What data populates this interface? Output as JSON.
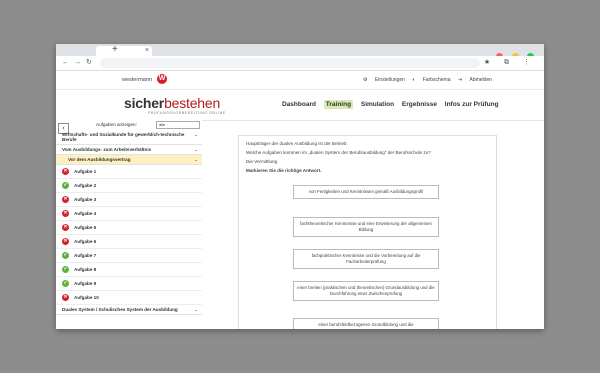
{
  "browser": {
    "newtab": "+",
    "tab_close": "×",
    "nav": {
      "back": "←",
      "forward": "→",
      "reload": "↻"
    },
    "omni_icons": "★ ⧉ ⋮",
    "dot_colors": [
      "#ff5f57",
      "#febc2e",
      "#28c840"
    ]
  },
  "topbar": {
    "brand": "westermann",
    "logo_letter": "W",
    "links": [
      "Einstellungen",
      "Farbschema",
      "Abmelden"
    ]
  },
  "header": {
    "logo_part1": "sicher",
    "logo_part2": "bestehen",
    "tagline": "PRÜFUNGSVORBEREITUNG ONLINE",
    "nav": [
      "Dashboard",
      "Training",
      "Simulation",
      "Ergebnisse",
      "Infos zur Prüfung"
    ],
    "active_nav": "Training"
  },
  "sidebar": {
    "filter_label": "Aufgaben anzeigen:",
    "filter_value": "alle",
    "collapse_icon": "‹",
    "chevron": "⌄",
    "sections": [
      "Wirtschafts- und Sozialkunde für gewerblich-technische Berufe",
      "Vom Ausbildungs- zum Arbeitsverhältnis",
      "Vor dem Ausbildungsvertrag"
    ],
    "tasks": [
      {
        "label": "Aufgabe 1",
        "status": "wrong",
        "mark": "✕"
      },
      {
        "label": "Aufgabe 2",
        "status": "correct",
        "mark": "✓"
      },
      {
        "label": "Aufgabe 3",
        "status": "wrong",
        "mark": "✕"
      },
      {
        "label": "Aufgabe 4",
        "status": "wrong",
        "mark": "✕"
      },
      {
        "label": "Aufgabe 5",
        "status": "wrong",
        "mark": "✕"
      },
      {
        "label": "Aufgabe 6",
        "status": "wrong",
        "mark": "✕"
      },
      {
        "label": "Aufgabe 7",
        "status": "correct",
        "mark": "✓"
      },
      {
        "label": "Aufgabe 8",
        "status": "correct",
        "mark": "✓"
      },
      {
        "label": "Aufgabe 9",
        "status": "correct",
        "mark": "✓"
      },
      {
        "label": "Aufgabe 10",
        "status": "wrong",
        "mark": "✕"
      }
    ],
    "section_after": "Duales System / Schulisches System der Ausbildung"
  },
  "question": {
    "line1": "Hauptträger der dualen Ausbildung ist der Betrieb.",
    "line2": "Welche Aufgaben kommen im „dualen System der Berufsausbildung“ der Berufsschule zu?",
    "line3": "Die Vermittlung",
    "instruction": "Markieren Sie die richtige Antwort.",
    "answers": [
      "von Fertigkeiten und Kenntnissen gemäß Ausbildungsprofil",
      "fachtheoretischer Kenntnisse und eine Erweiterung der allgemeinen Bildung",
      "fachpraktischer Kenntnisse und die Vorbereitung auf die Facharbeiterprüfung",
      "einer breiten (praktischen und theoretischen) Grundausbildung und die Durchführung einer Zwischenprüfung",
      "einer berufsfeldbezogenen Grundbildung und die"
    ]
  }
}
